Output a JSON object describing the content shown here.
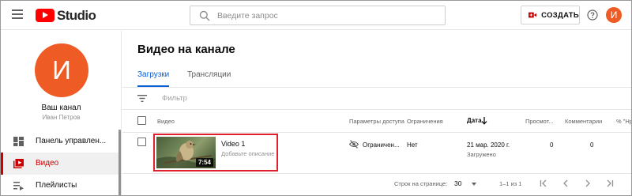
{
  "app": {
    "logo_text": "Studio"
  },
  "search": {
    "placeholder": "Введите запрос"
  },
  "header": {
    "create_label": "СОЗДАТЬ",
    "avatar_letter": "И"
  },
  "channel": {
    "avatar_letter": "И",
    "title": "Ваш канал",
    "owner": "Иван Петров"
  },
  "sidebar": {
    "items": [
      {
        "label": "Панель управлен...",
        "icon": "dashboard-icon",
        "active": false
      },
      {
        "label": "Видео",
        "icon": "video-library-icon",
        "active": true
      },
      {
        "label": "Плейлисты",
        "icon": "playlist-icon",
        "active": false
      }
    ]
  },
  "main": {
    "title": "Видео на канале",
    "tabs": [
      {
        "label": "Загрузки",
        "active": true
      },
      {
        "label": "Трансляции",
        "active": false
      }
    ],
    "filter_label": "Фильтр"
  },
  "table": {
    "headers": {
      "video": "Видео",
      "visibility": "Параметры доступа",
      "restrictions": "Ограничения",
      "date": "Дата",
      "views": "Просмот...",
      "comments": "Комментарии",
      "likes": "% \"Нр..."
    },
    "rows": [
      {
        "title": "Video 1",
        "description": "Добавьте описание",
        "duration": "7:54",
        "visibility": "Ограничен...",
        "restrictions": "Нет",
        "date": "21 мар. 2020 г.",
        "date_status": "Загружено",
        "views": "0",
        "comments": "0"
      }
    ]
  },
  "pagination": {
    "rows_per_page_label": "Строк на странице:",
    "rows_per_page": "30",
    "range": "1–1 из 1"
  },
  "colors": {
    "accent": "#065fd4",
    "brand_red": "#ff0000",
    "avatar": "#ef5b24",
    "highlight": "#e0202d"
  }
}
